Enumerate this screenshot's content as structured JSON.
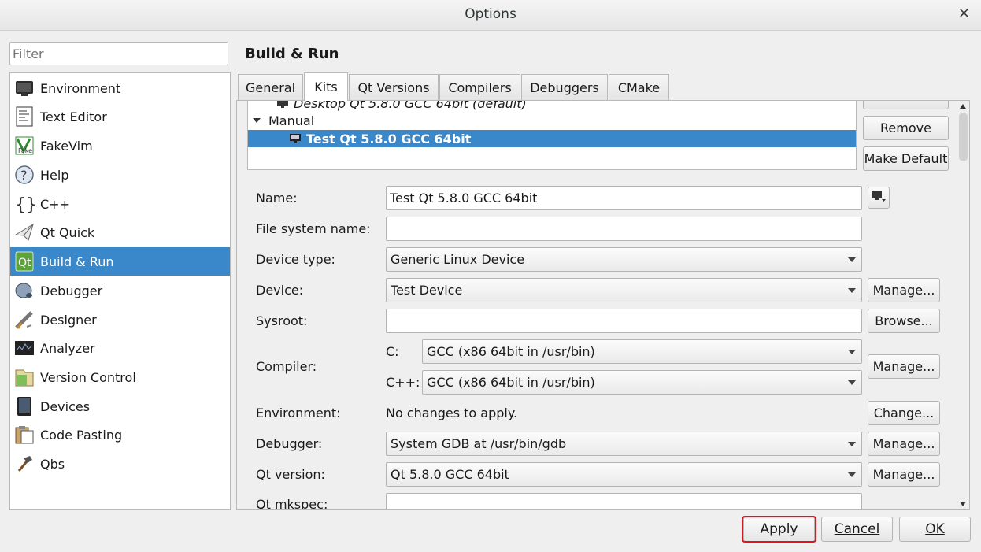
{
  "window": {
    "title": "Options",
    "close_glyph": "×"
  },
  "filter": {
    "placeholder": "Filter"
  },
  "sidebar": {
    "items": [
      {
        "label": "Environment",
        "icon": "monitor-icon"
      },
      {
        "label": "Text Editor",
        "icon": "text-editor-icon"
      },
      {
        "label": "FakeVim",
        "icon": "fakevim-icon"
      },
      {
        "label": "Help",
        "icon": "help-icon"
      },
      {
        "label": "C++",
        "icon": "braces-icon"
      },
      {
        "label": "Qt Quick",
        "icon": "paper-plane-icon"
      },
      {
        "label": "Build & Run",
        "icon": "qt-build-icon",
        "selected": true
      },
      {
        "label": "Debugger",
        "icon": "bug-icon"
      },
      {
        "label": "Designer",
        "icon": "ruler-icon"
      },
      {
        "label": "Analyzer",
        "icon": "analyzer-icon"
      },
      {
        "label": "Version Control",
        "icon": "folder-icon"
      },
      {
        "label": "Devices",
        "icon": "tablet-icon"
      },
      {
        "label": "Code Pasting",
        "icon": "clipboard-icon"
      },
      {
        "label": "Qbs",
        "icon": "hammer-icon"
      }
    ]
  },
  "page": {
    "title": "Build & Run"
  },
  "tabs": [
    {
      "label": "General"
    },
    {
      "label": "Kits",
      "active": true
    },
    {
      "label": "Qt Versions"
    },
    {
      "label": "Compilers"
    },
    {
      "label": "Debuggers"
    },
    {
      "label": "CMake"
    }
  ],
  "kits_tree": {
    "partial_row": "Desktop Qt 5.8.0 GCC 64bit (default)",
    "manual_group": "Manual",
    "selected_kit": "Test Qt 5.8.0 GCC 64bit"
  },
  "kit_buttons": {
    "remove": "Remove",
    "make_default": "Make Default"
  },
  "form": {
    "name_label": "Name:",
    "name_value": "Test Qt 5.8.0 GCC 64bit",
    "fs_label": "File system name:",
    "fs_value": "",
    "device_type_label": "Device type:",
    "device_type_value": "Generic Linux Device",
    "device_label": "Device:",
    "device_value": "Test Device",
    "device_manage": "Manage...",
    "sysroot_label": "Sysroot:",
    "sysroot_value": "",
    "sysroot_browse": "Browse...",
    "compiler_label": "Compiler:",
    "compiler_c_label": "C:",
    "compiler_c_value": "GCC (x86 64bit in /usr/bin)",
    "compiler_cpp_label": "C++:",
    "compiler_cpp_value": "GCC (x86 64bit in /usr/bin)",
    "compiler_manage": "Manage...",
    "env_label": "Environment:",
    "env_value": "No changes to apply.",
    "env_change": "Change...",
    "debugger_label": "Debugger:",
    "debugger_value": "System GDB at /usr/bin/gdb",
    "debugger_manage": "Manage...",
    "qtver_label": "Qt version:",
    "qtver_value": "Qt 5.8.0 GCC 64bit",
    "qtver_manage": "Manage...",
    "mkspec_label": "Qt mkspec:",
    "mkspec_value": ""
  },
  "footer": {
    "apply": "Apply",
    "cancel": "Cancel",
    "ok": "OK"
  },
  "colors": {
    "selection": "#3a87c9",
    "highlight": "#e0141e"
  }
}
